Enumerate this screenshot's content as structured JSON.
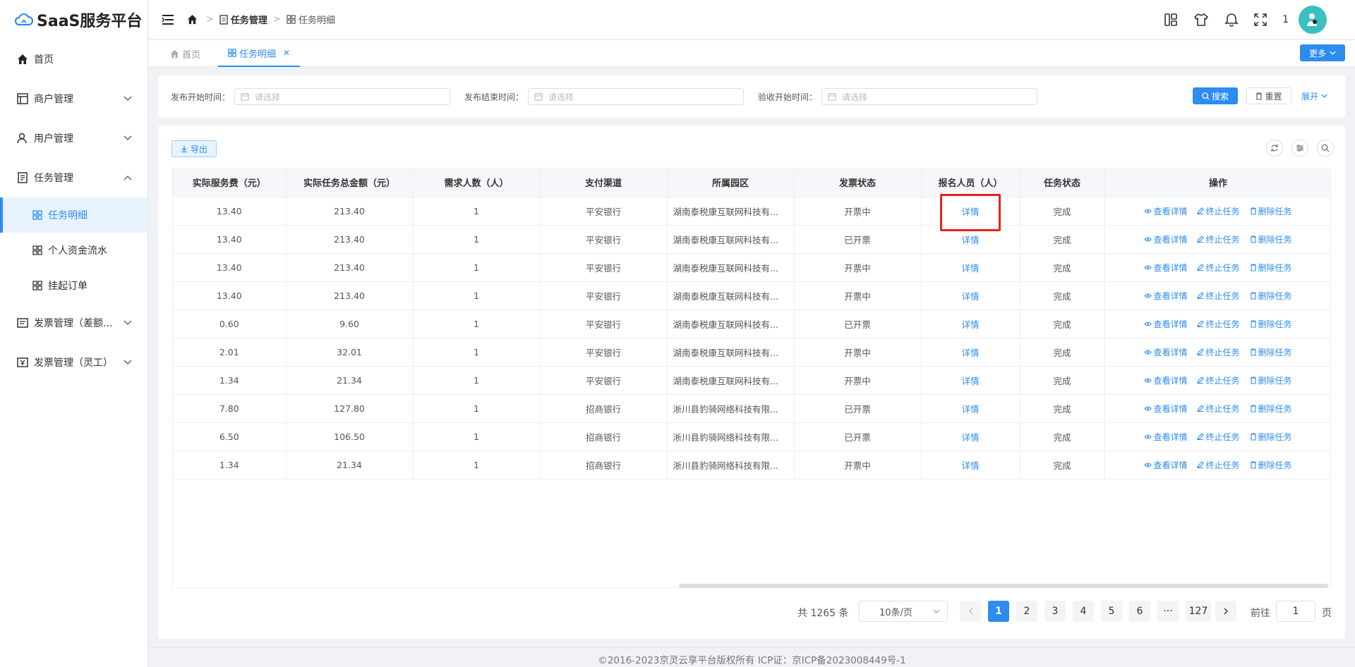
{
  "app": {
    "title": "SaaS服务平台"
  },
  "sidebar": {
    "items": [
      {
        "label": "首页",
        "icon": "home-icon"
      },
      {
        "label": "商户管理",
        "icon": "shop-icon"
      },
      {
        "label": "用户管理",
        "icon": "user-icon"
      },
      {
        "label": "任务管理",
        "icon": "task-icon"
      },
      {
        "label": "发票管理（差额...",
        "icon": "invoice-icon"
      },
      {
        "label": "发票管理（灵工）",
        "icon": "invoice-icon"
      }
    ],
    "sub_items": [
      {
        "label": "任务明细",
        "active": true
      },
      {
        "label": "个人资金流水",
        "active": false
      },
      {
        "label": "挂起订单",
        "active": false
      }
    ]
  },
  "header": {
    "breadcrumb": [
      "任务管理",
      "任务明细"
    ],
    "badge_count": "1"
  },
  "tabs": [
    {
      "label": "首页",
      "active": false
    },
    {
      "label": "任务明细",
      "active": true
    }
  ],
  "more_label": "更多",
  "filters": [
    {
      "label": "发布开始时间：",
      "placeholder": "请选择"
    },
    {
      "label": "发布结束时间：",
      "placeholder": "请选择"
    },
    {
      "label": "验收开始时间：",
      "placeholder": "请选择"
    }
  ],
  "buttons": {
    "search": "搜索",
    "reset": "重置",
    "expand": "展开",
    "export": "导出"
  },
  "table": {
    "columns": [
      "实际服务费（元）",
      "实际任务总金额（元）",
      "需求人数（人）",
      "支付渠道",
      "所属园区",
      "发票状态",
      "报名人员（人）",
      "任务状态",
      "操作"
    ],
    "rows": [
      [
        "13.40",
        "213.40",
        "1",
        "平安银行",
        "湖南泰税康互联网科技有...",
        "开票中",
        "详情",
        "完成"
      ],
      [
        "13.40",
        "213.40",
        "1",
        "平安银行",
        "湖南泰税康互联网科技有...",
        "已开票",
        "详情",
        "完成"
      ],
      [
        "13.40",
        "213.40",
        "1",
        "平安银行",
        "湖南泰税康互联网科技有...",
        "开票中",
        "详情",
        "完成"
      ],
      [
        "13.40",
        "213.40",
        "1",
        "平安银行",
        "湖南泰税康互联网科技有...",
        "开票中",
        "详情",
        "完成"
      ],
      [
        "0.60",
        "9.60",
        "1",
        "平安银行",
        "湖南泰税康互联网科技有...",
        "已开票",
        "详情",
        "完成"
      ],
      [
        "2.01",
        "32.01",
        "1",
        "平安银行",
        "湖南泰税康互联网科技有...",
        "开票中",
        "详情",
        "完成"
      ],
      [
        "1.34",
        "21.34",
        "1",
        "平安银行",
        "湖南泰税康互联网科技有...",
        "开票中",
        "详情",
        "完成"
      ],
      [
        "7.80",
        "127.80",
        "1",
        "招商银行",
        "淅川县豹骑网络科技有限...",
        "已开票",
        "详情",
        "完成"
      ],
      [
        "6.50",
        "106.50",
        "1",
        "招商银行",
        "淅川县豹骑网络科技有限...",
        "已开票",
        "详情",
        "完成"
      ],
      [
        "1.34",
        "21.34",
        "1",
        "招商银行",
        "淅川县豹骑网络科技有限...",
        "开票中",
        "详情",
        "完成"
      ]
    ],
    "row_actions": [
      "查看详情",
      "终止任务",
      "删除任务"
    ]
  },
  "pagination": {
    "total_text": "共 1265 条",
    "page_size": "10条/页",
    "pages": [
      "1",
      "2",
      "3",
      "4",
      "5",
      "6",
      "···",
      "127"
    ],
    "current": "1",
    "goto_label": "前往",
    "goto_value": "1",
    "page_suffix": "页"
  },
  "footer": "©2016-2023京灵云享平台版权所有 ICP证：京ICP备2023008449号-1",
  "colors": {
    "primary": "#2d8cf0",
    "highlight": "#e8211d",
    "avatar": "#3bbfbf"
  }
}
